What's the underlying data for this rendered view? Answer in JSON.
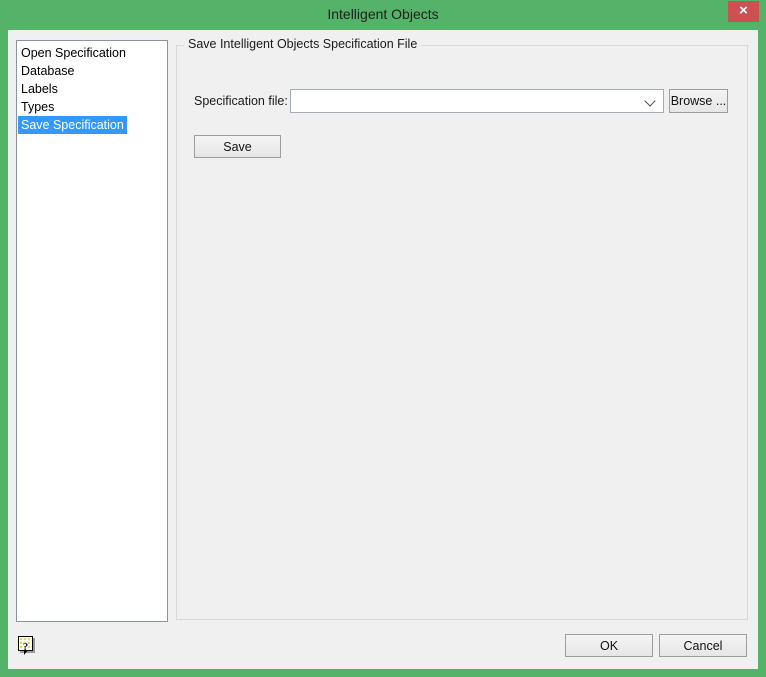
{
  "window": {
    "title": "Intelligent Objects",
    "close_glyph": "×"
  },
  "sidebar": {
    "items": [
      {
        "label": "Open Specification",
        "selected": false
      },
      {
        "label": "Database",
        "selected": false
      },
      {
        "label": "Labels",
        "selected": false
      },
      {
        "label": "Types",
        "selected": false
      },
      {
        "label": "Save Specification",
        "selected": true
      }
    ]
  },
  "main": {
    "group_title": "Save Intelligent Objects Specification File",
    "specification_file_label": "Specification file:",
    "specification_file_value": "",
    "browse_button_label": "Browse ...",
    "save_button_label": "Save"
  },
  "footer": {
    "help_icon_glyph": "?",
    "ok_button_label": "OK",
    "cancel_button_label": "Cancel"
  },
  "colors": {
    "titlebar_green": "#55b269",
    "close_red": "#cd5152",
    "selection_blue": "#3399ff",
    "client_bg": "#f0f0f0"
  }
}
